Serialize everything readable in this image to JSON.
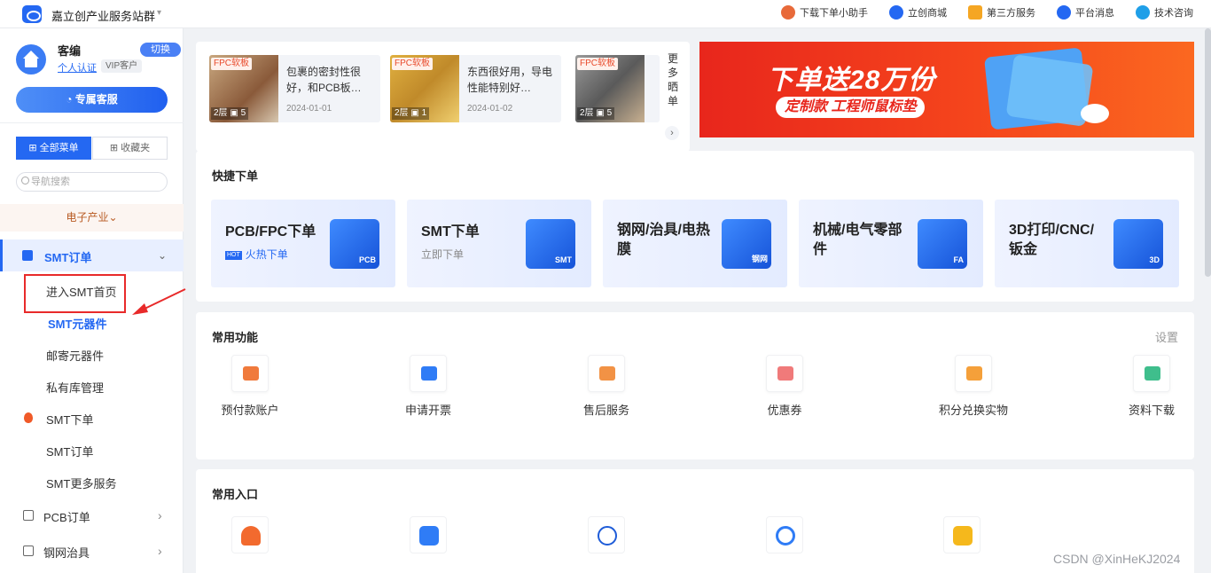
{
  "header": {
    "brand": "嘉立创产业服务站群",
    "links": [
      {
        "label": "下载下单小助手",
        "color": "#e86a3a"
      },
      {
        "label": "立创商城",
        "color": "#2468f2"
      },
      {
        "label": "第三方服务",
        "color": "#f5a623"
      },
      {
        "label": "平台消息",
        "color": "#2468f2"
      },
      {
        "label": "技术咨询",
        "color": "#1f9fe8"
      }
    ]
  },
  "user": {
    "name": "客编",
    "switch_label": "切换",
    "cert_link": "个人认证",
    "vip_badge": "VIP客户",
    "service_button": "专属客服"
  },
  "sidebar": {
    "tab_all": "全部菜单",
    "tab_fav": "收藏夹",
    "search_placeholder": "导航搜索",
    "industry": "电子产业",
    "smt_section": "SMT订单",
    "sub_items": [
      "进入SMT首页",
      "SMT元器件",
      "邮寄元器件",
      "私有库管理",
      "SMT下单",
      "SMT订单",
      "SMT更多服务"
    ],
    "active_item": "SMT元器件",
    "top_items": [
      "PCB订单",
      "钢网治具"
    ]
  },
  "cases": [
    {
      "tag": "FPC软板",
      "layers": "2层",
      "images": "5",
      "text": "包裹的密封性很好，和PCB板…",
      "date": "2024-01-01"
    },
    {
      "tag": "FPC软板",
      "layers": "2层",
      "images": "1",
      "text": "东西很好用，导电性能特别好…",
      "date": "2024-01-02"
    },
    {
      "tag": "FPC软板",
      "layers": "2层",
      "images": "5",
      "text": "",
      "date": ""
    }
  ],
  "cases_more": "更多晒单",
  "banner": {
    "title": "下单送28万份",
    "subtitle": "定制款 工程师鼠标垫"
  },
  "quick_order": {
    "title": "快捷下单",
    "cards": [
      {
        "title": "PCB/FPC下单",
        "sub": "火热下单",
        "hot_tag": "HOT",
        "icon": "PCB"
      },
      {
        "title": "SMT下单",
        "sub": "立即下单",
        "hot_tag": "",
        "icon": "SMT"
      },
      {
        "title": "钢网/治具/电热膜",
        "sub": "",
        "hot_tag": "",
        "icon": "钢网"
      },
      {
        "title": "机械/电气零部件",
        "sub": "",
        "hot_tag": "",
        "icon": "FA"
      },
      {
        "title": "3D打印/CNC/钣金",
        "sub": "",
        "hot_tag": "",
        "icon": "3D"
      }
    ]
  },
  "common_functions": {
    "title": "常用功能",
    "settings": "设置",
    "items": [
      {
        "label": "预付款账户",
        "color": "#f07a3c"
      },
      {
        "label": "申请开票",
        "color": "#2f7cf6"
      },
      {
        "label": "售后服务",
        "color": "#f29245"
      },
      {
        "label": "优惠券",
        "color": "#f07a7a"
      },
      {
        "label": "积分兑换实物",
        "color": "#f5a03a"
      },
      {
        "label": "资料下载",
        "color": "#3fbe8c"
      }
    ]
  },
  "common_entries": {
    "title": "常用入口",
    "icons": [
      {
        "name": "jlc-entry-icon",
        "color": "#f26a2e"
      },
      {
        "name": "shop-bag-entry-icon",
        "color": "#2f7cf6"
      },
      {
        "name": "lcsc-entry-icon",
        "color": "#1e5cd8"
      },
      {
        "name": "headset-entry-icon",
        "color": "#2f7cf6"
      },
      {
        "name": "apps-entry-icon",
        "color": "#f5b81c"
      }
    ]
  },
  "watermark": "CSDN @XinHeKJ2024"
}
